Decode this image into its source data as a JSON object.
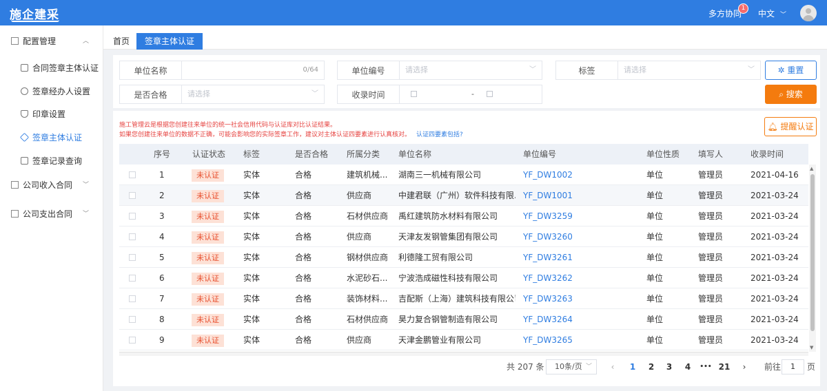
{
  "app": {
    "logo": "施企建采",
    "collab": "多方协同",
    "badge": "1",
    "lang": "中文"
  },
  "sidebar": {
    "groups": [
      {
        "label": "配置管理"
      },
      {
        "label": "公司收入合同"
      },
      {
        "label": "公司支出合同"
      }
    ],
    "items": [
      {
        "label": "合同签章主体认证"
      },
      {
        "label": "签章经办人设置"
      },
      {
        "label": "印章设置"
      },
      {
        "label": "签章主体认证"
      },
      {
        "label": "签章记录查询"
      }
    ]
  },
  "tabs": [
    {
      "label": "首页"
    },
    {
      "label": "签章主体认证"
    }
  ],
  "filters": {
    "unit_name_label": "单位名称",
    "unit_name_count": "0/64",
    "unit_code_label": "单位编号",
    "unit_code_placeholder": "请选择",
    "tag_label": "标签",
    "tag_placeholder": "请选择",
    "qualified_label": "是否合格",
    "qualified_placeholder": "请选择",
    "date_label": "收录时间",
    "date_sep": "-",
    "reset_label": "重置",
    "search_label": "搜索"
  },
  "notice": {
    "line1": "施工管理云是根据您创建往来单位的统一社会信用代码与认证库对比认证结果。",
    "line2": "如果您创建往来单位的数据不正确，可能会影响您的实际签章工作，建议对主体认证四要素进行认真核对。",
    "link": "认证四要素包括?",
    "remind_label": "提醒认证"
  },
  "table": {
    "headers": [
      "序号",
      "认证状态",
      "标签",
      "是否合格",
      "所属分类",
      "单位名称",
      "单位编号",
      "单位性质",
      "填写人",
      "收录时间"
    ],
    "rows": [
      {
        "no": "1",
        "status": "未认证",
        "tag": "实体",
        "ok": "合格",
        "cat": "建筑机械...",
        "name": "湖南三一机械有限公司",
        "code": "YF_DW1002",
        "nature": "单位",
        "filler": "管理员",
        "date": "2021-04-16"
      },
      {
        "no": "2",
        "status": "未认证",
        "tag": "实体",
        "ok": "合格",
        "cat": "供应商",
        "name": "中建君联（广州）软件科技有限...",
        "code": "YF_DW1001",
        "nature": "单位",
        "filler": "管理员",
        "date": "2021-03-24"
      },
      {
        "no": "3",
        "status": "未认证",
        "tag": "实体",
        "ok": "合格",
        "cat": "石材供应商",
        "name": "禹红建筑防水材料有限公司",
        "code": "YF_DW3259",
        "nature": "单位",
        "filler": "管理员",
        "date": "2021-03-24"
      },
      {
        "no": "4",
        "status": "未认证",
        "tag": "实体",
        "ok": "合格",
        "cat": "供应商",
        "name": "天津友发钢管集团有限公司",
        "code": "YF_DW3260",
        "nature": "单位",
        "filler": "管理员",
        "date": "2021-03-24"
      },
      {
        "no": "5",
        "status": "未认证",
        "tag": "实体",
        "ok": "合格",
        "cat": "钢材供应商",
        "name": "利德隆工贸有限公司",
        "code": "YF_DW3261",
        "nature": "单位",
        "filler": "管理员",
        "date": "2021-03-24"
      },
      {
        "no": "6",
        "status": "未认证",
        "tag": "实体",
        "ok": "合格",
        "cat": "水泥砂石...",
        "name": "宁波浩成磁性科技有限公司",
        "code": "YF_DW3262",
        "nature": "单位",
        "filler": "管理员",
        "date": "2021-03-24"
      },
      {
        "no": "7",
        "status": "未认证",
        "tag": "实体",
        "ok": "合格",
        "cat": "装饰材料...",
        "name": "吉配斯（上海）建筑科技有限公司",
        "code": "YF_DW3263",
        "nature": "单位",
        "filler": "管理员",
        "date": "2021-03-24"
      },
      {
        "no": "8",
        "status": "未认证",
        "tag": "实体",
        "ok": "合格",
        "cat": "石材供应商",
        "name": "昊力复合钢管制造有限公司",
        "code": "YF_DW3264",
        "nature": "单位",
        "filler": "管理员",
        "date": "2021-03-24"
      },
      {
        "no": "9",
        "status": "未认证",
        "tag": "实体",
        "ok": "合格",
        "cat": "供应商",
        "name": "天津金鹏管业有限公司",
        "code": "YF_DW3265",
        "nature": "单位",
        "filler": "管理员",
        "date": "2021-03-24"
      }
    ]
  },
  "pagination": {
    "total": "共 207 条",
    "size": "10条/页",
    "pages": [
      "1",
      "2",
      "3",
      "4",
      "•••",
      "21"
    ],
    "goto_label": "前往",
    "goto_value": "1",
    "page_suffix": "页"
  }
}
